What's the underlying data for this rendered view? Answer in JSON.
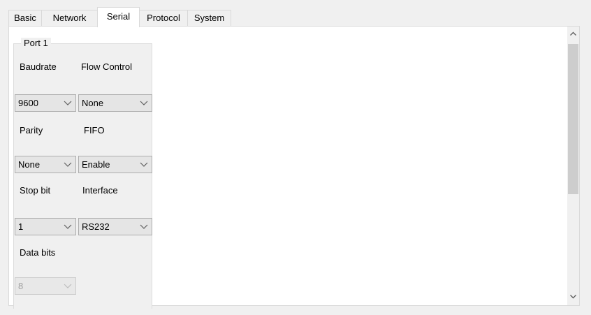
{
  "tabs": [
    {
      "label": "Basic"
    },
    {
      "label": "Network"
    },
    {
      "label": "Serial"
    },
    {
      "label": "Protocol"
    },
    {
      "label": "System"
    }
  ],
  "port": {
    "title": "Port 1",
    "baudrate_label": "Baudrate",
    "baudrate_value": "9600",
    "flow_control_label": "Flow Control",
    "flow_control_value": "None",
    "parity_label": "Parity",
    "parity_value": "None",
    "fifo_label": "FIFO",
    "fifo_value": "Enable",
    "stop_bit_label": "Stop bit",
    "stop_bit_value": "1",
    "interface_label": "Interface",
    "interface_value": "RS232",
    "data_bits_label": "Data bits",
    "data_bits_value": "8"
  },
  "icons": {
    "dropdown": "chevron-down-icon",
    "scroll_up": "chevron-up-icon",
    "scroll_down": "chevron-down-icon"
  },
  "colors": {
    "background": "#f0f0f0",
    "panel": "#ffffff",
    "border": "#d9d9d9",
    "combo_bg": "#e5e5e5",
    "disabled_text": "#a0a0a0",
    "scroll_thumb": "#cdcdcd"
  }
}
